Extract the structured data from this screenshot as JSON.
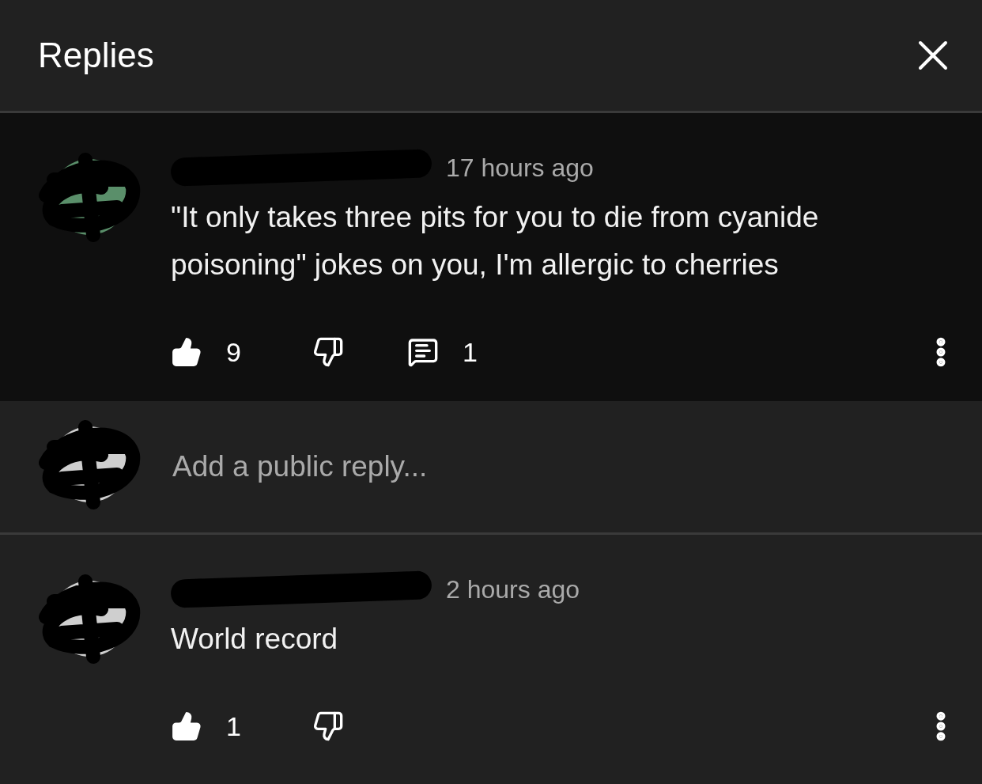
{
  "header": {
    "title": "Replies"
  },
  "comments": [
    {
      "kind": "comment",
      "highlighted": true,
      "time": "17 hours ago",
      "text": "\"It only takes three pits for you to die from cyanide poisoning\" jokes on you, I'm allergic to cherries",
      "likes": "9",
      "replies": "1"
    },
    {
      "kind": "reply_box",
      "placeholder": "Add a public reply..."
    },
    {
      "kind": "comment",
      "highlighted": false,
      "time": "2 hours ago",
      "text": "World record",
      "likes": "1"
    }
  ]
}
